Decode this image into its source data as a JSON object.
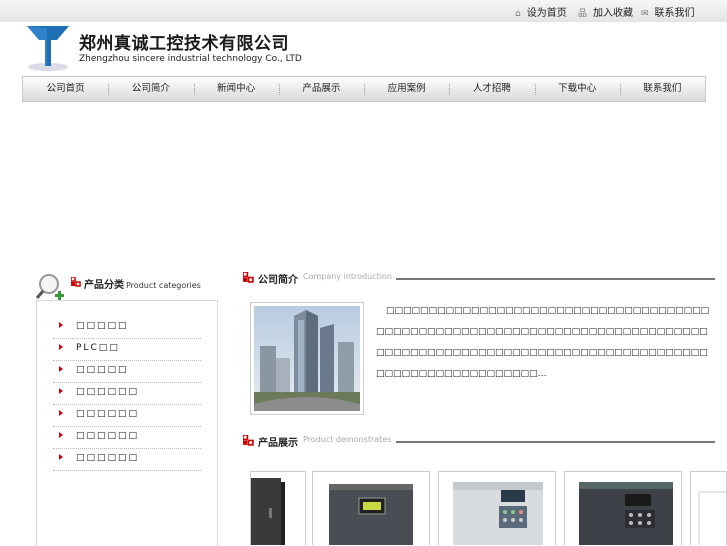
{
  "topbar": {
    "links": [
      {
        "icon": "home-icon",
        "label": "设为首页"
      },
      {
        "icon": "bookmark-icon",
        "label": "加入收藏"
      },
      {
        "icon": "mail-icon",
        "label": "联系我们"
      }
    ]
  },
  "header": {
    "company_cn": "郑州真诚工控技术有限公司",
    "company_en": "Zhengzhou sincere industrial technology Co., LTD"
  },
  "nav": {
    "items": [
      "公司首页",
      "公司简介",
      "新闻中心",
      "产品展示",
      "应用案例",
      "人才招聘",
      "下载中心",
      "联系我们"
    ]
  },
  "sidebar": {
    "title_cn": "产品分类",
    "title_en": "Product categories",
    "categories": [
      "□□□□□",
      "PLC□□",
      "□□□□□",
      "□□□□□□",
      "□□□□□□",
      "□□□□□□",
      "□□□□□□"
    ]
  },
  "about": {
    "title_cn": "公司简介",
    "title_en": "Company introduction",
    "text": "□□□□□□□□□□□□□□□□□□□□□□□□□□□□□□□□□□□□□□□□□□□□□□□□□□□□□□□□□□□□□□□□□□□□□□□□□□□□□□□□□□□□□□□□□□□□□□□□□□□□□□□□□□□□□□□□□□□□□□□□□□□□□□□□□□□□□□□…"
  },
  "products": {
    "title_cn": "产品展示",
    "title_en": "Product demonstrates"
  },
  "colors": {
    "accent_red": "#cc0000",
    "logo_blue": "#1f6fb5"
  }
}
